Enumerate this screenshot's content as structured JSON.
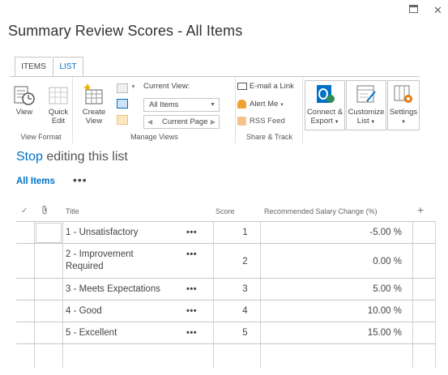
{
  "dialog": {
    "title": "Summary Review Scores - All Items"
  },
  "ribbon": {
    "tabs": [
      {
        "label": "ITEMS"
      },
      {
        "label": "LIST"
      }
    ],
    "view_format": {
      "label": "View Format",
      "view": "View",
      "quick_edit_line1": "Quick",
      "quick_edit_line2": "Edit"
    },
    "manage_views": {
      "label": "Manage Views",
      "create_view_line1": "Create",
      "create_view_line2": "View",
      "current_view_label": "Current View:",
      "current_view_value": "All Items",
      "current_page": "Current Page"
    },
    "share_track": {
      "label": "Share & Track",
      "email_link": "E-mail a Link",
      "alert_me": "Alert Me",
      "rss_feed": "RSS Feed"
    },
    "connect": {
      "line1": "Connect &",
      "line2": "Export"
    },
    "customize": {
      "line1": "Customize",
      "line2": "List"
    },
    "settings": {
      "line1": "Settings"
    }
  },
  "editing": {
    "link": "Stop",
    "rest": " editing this list"
  },
  "view": {
    "name": "All Items",
    "more": "•••"
  },
  "columns": {
    "title": "Title",
    "score": "Score",
    "salary": "Recommended Salary Change (%)"
  },
  "rows": [
    {
      "title": "1 - Unsatisfactory",
      "score": "1",
      "salary": "-5.00 %"
    },
    {
      "title": "2 - Improvement Required",
      "score": "2",
      "salary": "0.00 %"
    },
    {
      "title": "3 - Meets Expectations",
      "score": "3",
      "salary": "5.00 %"
    },
    {
      "title": "4 - Good",
      "score": "4",
      "salary": "10.00 %"
    },
    {
      "title": "5 - Excellent",
      "score": "5",
      "salary": "15.00 %"
    }
  ],
  "row_menu": "•••",
  "add_column": "+"
}
